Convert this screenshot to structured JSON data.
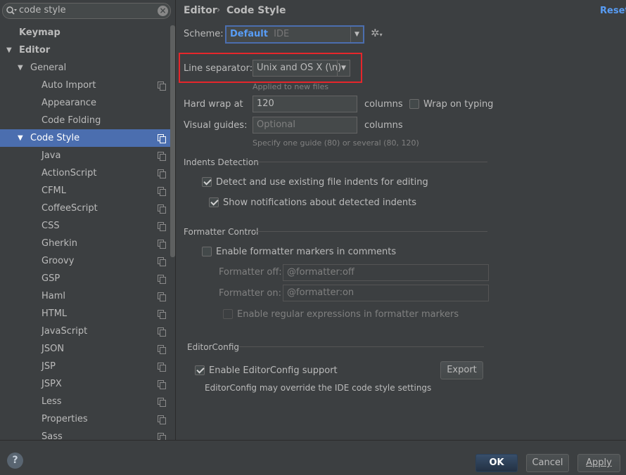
{
  "search": {
    "value": "code style"
  },
  "sidebar": {
    "items": [
      {
        "label": "Keymap"
      },
      {
        "label": "Editor"
      },
      {
        "label": "General"
      },
      {
        "label": "Auto Import"
      },
      {
        "label": "Appearance"
      },
      {
        "label": "Code Folding"
      },
      {
        "label": "Code Style"
      },
      {
        "label": "Java"
      },
      {
        "label": "ActionScript"
      },
      {
        "label": "CFML"
      },
      {
        "label": "CoffeeScript"
      },
      {
        "label": "CSS"
      },
      {
        "label": "Gherkin"
      },
      {
        "label": "Groovy"
      },
      {
        "label": "GSP"
      },
      {
        "label": "Haml"
      },
      {
        "label": "HTML"
      },
      {
        "label": "JavaScript"
      },
      {
        "label": "JSON"
      },
      {
        "label": "JSP"
      },
      {
        "label": "JSPX"
      },
      {
        "label": "Less"
      },
      {
        "label": "Properties"
      },
      {
        "label": "Sass"
      }
    ]
  },
  "header": {
    "crumb_root": "Editor",
    "crumb_sep": "›",
    "crumb_current": "Code Style",
    "reset": "Reset"
  },
  "scheme": {
    "label": "Scheme:",
    "name": "Default",
    "type": "IDE"
  },
  "line_separator": {
    "label": "Line separator:",
    "value": "Unix and OS X (\\n)",
    "hint": "Applied to new files"
  },
  "hard_wrap": {
    "label": "Hard wrap at",
    "value": "120",
    "unit": "columns",
    "wrap_on_typing": "Wrap on typing"
  },
  "visual_guides": {
    "label": "Visual guides:",
    "placeholder": "Optional",
    "unit": "columns",
    "hint": "Specify one guide (80) or several (80, 120)"
  },
  "indents": {
    "title": "Indents Detection",
    "detect": "Detect and use existing file indents for editing",
    "notify": "Show notifications about detected indents"
  },
  "formatter": {
    "title": "Formatter Control",
    "enable": "Enable formatter markers in comments",
    "off_label": "Formatter off:",
    "off_value": "@formatter:off",
    "on_label": "Formatter on:",
    "on_value": "@formatter:on",
    "regex": "Enable regular expressions in formatter markers"
  },
  "editorconfig": {
    "title": "EditorConfig",
    "enable": "Enable EditorConfig support",
    "export": "Export",
    "note": "EditorConfig may override the IDE code style settings"
  },
  "footer": {
    "help": "?",
    "ok": "OK",
    "cancel": "Cancel",
    "apply": "Apply"
  },
  "colors": {
    "accent": "#589df6",
    "selection": "#4b6eaf",
    "highlight_box": "#e6262b"
  }
}
